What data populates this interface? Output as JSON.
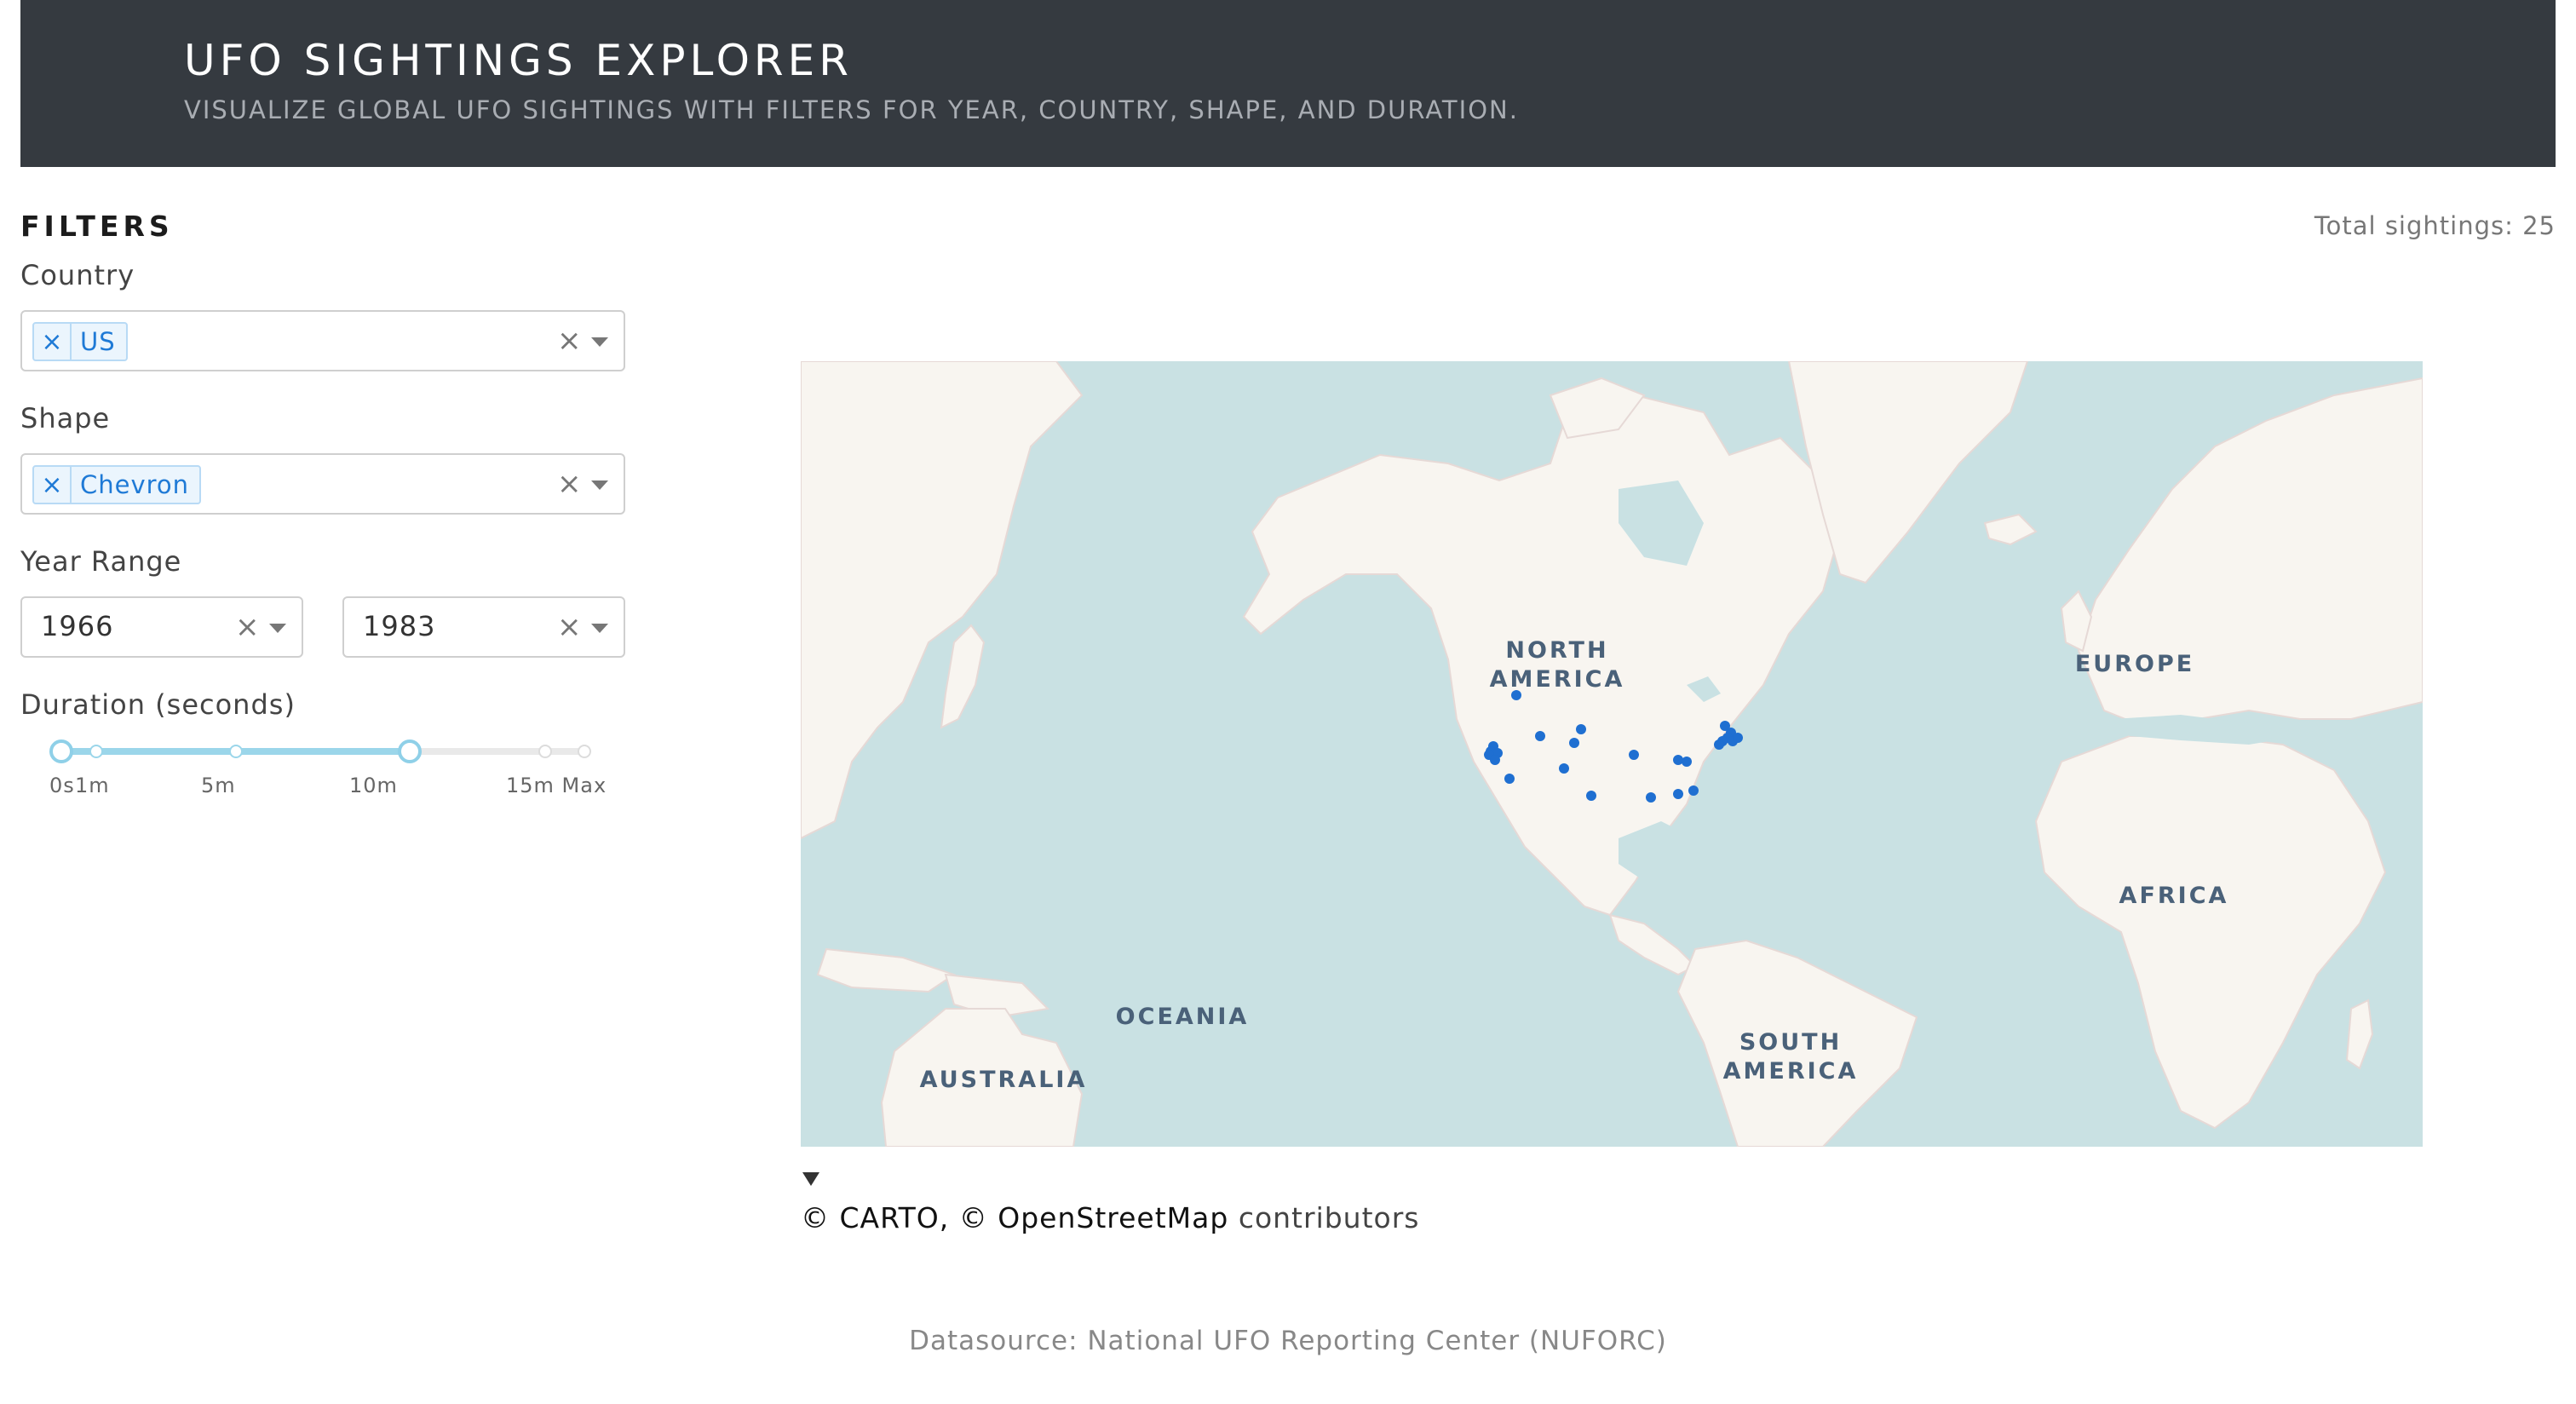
{
  "header": {
    "title": "UFO SIGHTINGS EXPLORER",
    "subtitle": "VISUALIZE GLOBAL UFO SIGHTINGS WITH FILTERS FOR YEAR, COUNTRY, SHAPE, AND DURATION."
  },
  "filters": {
    "heading": "FILTERS",
    "country": {
      "label": "Country",
      "selected": [
        "US"
      ]
    },
    "shape": {
      "label": "Shape",
      "selected": [
        "Chevron"
      ]
    },
    "year_range": {
      "label": "Year Range",
      "from": "1966",
      "to": "1983"
    },
    "duration": {
      "label": "Duration (seconds)",
      "marks": [
        "0s",
        "1m",
        "5m",
        "10m",
        "15m Max"
      ],
      "range_minutes": [
        0,
        10
      ],
      "max_minutes": 15
    }
  },
  "summary": {
    "total_text": "Total sightings: 25"
  },
  "map": {
    "continent_labels": [
      "NORTH",
      "AMERICA",
      "EUROPE",
      "AFRICA",
      "OCEANIA",
      "AUSTRALIA",
      "SOUTH",
      "AMERICA"
    ],
    "point_color": "#1f6fd1",
    "ocean_color": "#c9e1e3",
    "land_color": "#f8f5f0"
  },
  "attribution": {
    "carto": "© CARTO, ©",
    "osm": "OpenStreetMap",
    "rest": "contributors"
  },
  "footer": {
    "text": "Datasource: National UFO Reporting Center (NUFORC)"
  }
}
